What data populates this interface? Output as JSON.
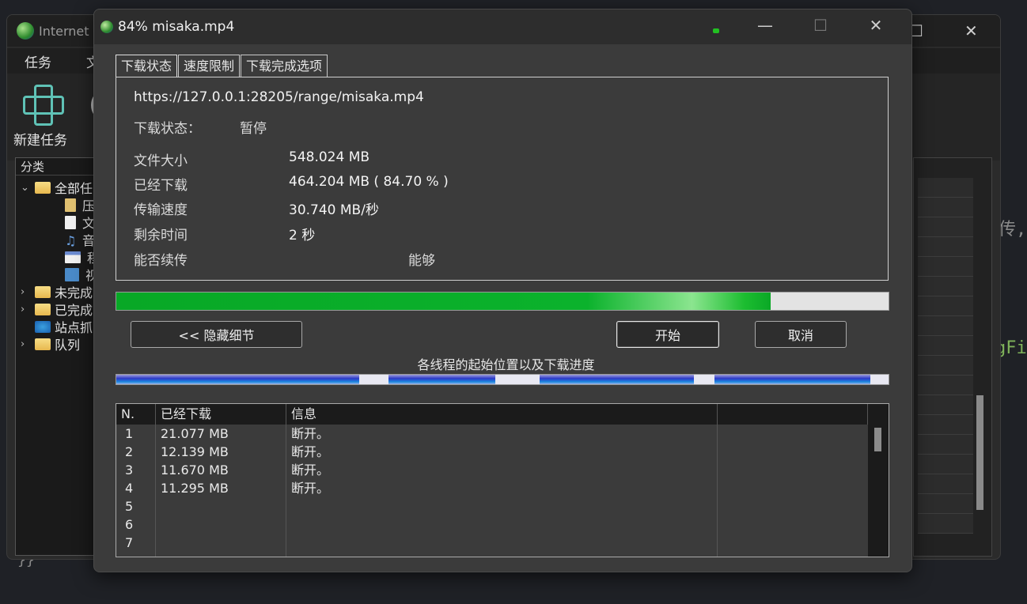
{
  "background_editor": {
    "char_right": "传,",
    "code_fragment": "gFi",
    "brace": "}}"
  },
  "main_window": {
    "title": "Internet Download Manager",
    "title_visible": "Internet D",
    "menu": [
      "任务",
      "文"
    ],
    "new_task_label": "新建任务",
    "category_header": "分类",
    "tree": [
      {
        "label": "全部任",
        "level": 0,
        "expanded": true
      },
      {
        "label": "压",
        "level": 1
      },
      {
        "label": "文",
        "level": 1
      },
      {
        "label": "音",
        "level": 1
      },
      {
        "label": "程",
        "level": 1
      },
      {
        "label": "视",
        "level": 1
      },
      {
        "label": "未完成",
        "level": 0
      },
      {
        "label": "已完成",
        "level": 0
      },
      {
        "label": "站点抓",
        "level": 0
      },
      {
        "label": "队列",
        "level": 0
      }
    ]
  },
  "dialog": {
    "title": "84% misaka.mp4",
    "tabs": [
      "下载状态",
      "速度限制",
      "下载完成选项"
    ],
    "url": "https://127.0.0.1:28205/range/misaka.mp4",
    "status_label": "下载状态：",
    "status_value": "暂停",
    "fields": [
      {
        "label": "文件大小",
        "value": "548.024  MB"
      },
      {
        "label": "已经下载",
        "value": "464.204  MB  ( 84.70 % )"
      },
      {
        "label": "传输速度",
        "value": "30.740  MB/秒"
      },
      {
        "label": "剩余时间",
        "value": "2 秒"
      },
      {
        "label": "能否续传",
        "value": "能够"
      }
    ],
    "progress": 0.847,
    "buttons": {
      "hide_details": "<< 隐藏细节",
      "start": "开始",
      "cancel": "取消"
    },
    "threads_label": "各线程的起始位置以及下载进度",
    "thread_segments": [
      {
        "start": 0.0,
        "end": 0.315
      },
      {
        "start": 0.352,
        "end": 0.491
      },
      {
        "start": 0.548,
        "end": 0.748
      },
      {
        "start": 0.775,
        "end": 0.976
      }
    ],
    "table": {
      "columns": [
        "N.",
        "已经下载",
        "信息",
        ""
      ],
      "rows": [
        {
          "n": "1",
          "downloaded": "21.077  MB",
          "info": "断开。"
        },
        {
          "n": "2",
          "downloaded": "12.139  MB",
          "info": "断开。"
        },
        {
          "n": "3",
          "downloaded": "11.670  MB",
          "info": "断开。"
        },
        {
          "n": "4",
          "downloaded": "11.295  MB",
          "info": "断开。"
        },
        {
          "n": "5",
          "downloaded": "",
          "info": ""
        },
        {
          "n": "6",
          "downloaded": "",
          "info": ""
        },
        {
          "n": "7",
          "downloaded": "",
          "info": ""
        }
      ]
    }
  }
}
